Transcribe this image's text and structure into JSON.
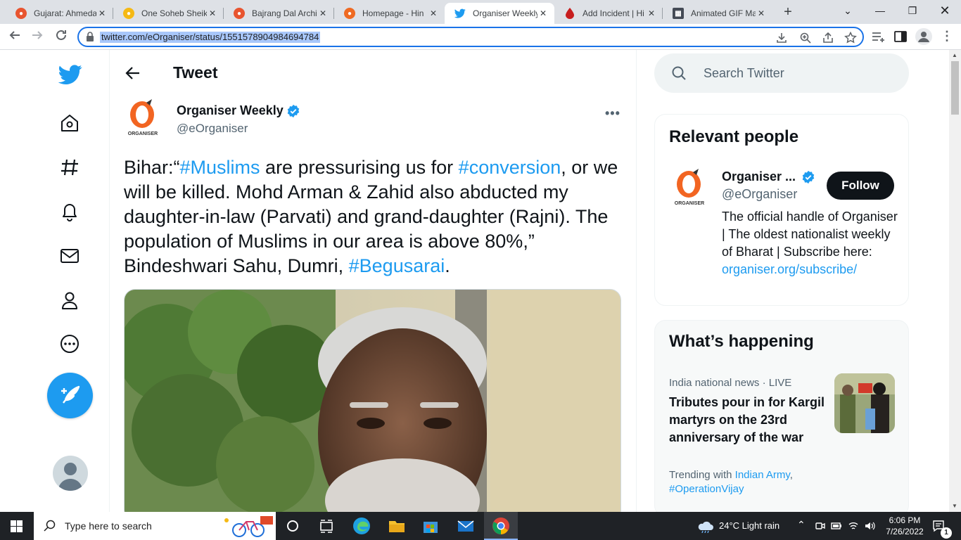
{
  "browser": {
    "tabs": [
      {
        "label": "Gujarat: Ahmedal",
        "color": "#e8542f",
        "active": false
      },
      {
        "label": "One Soheb Sheik",
        "color": "#f5b914",
        "active": false
      },
      {
        "label": "Bajrang Dal Archi",
        "color": "#e8542f",
        "active": false
      },
      {
        "label": "Homepage - Hin",
        "color": "#ef6a22",
        "active": false
      },
      {
        "label": "Organiser Weekly",
        "color": "#1d9bf0",
        "active": true
      },
      {
        "label": "Add Incident | Hi",
        "color": "#c71e1e",
        "active": false
      },
      {
        "label": "Animated GIF Ma",
        "color": "#444a55",
        "active": false
      }
    ],
    "url": "twitter.com/eOrganiser/status/1551578904984694784"
  },
  "nav": {
    "items": [
      "twitter-logo",
      "home-icon",
      "explore-icon",
      "notifications-icon",
      "messages-icon",
      "profile-icon",
      "more-icon"
    ]
  },
  "main": {
    "header_title": "Tweet",
    "author_name": "Organiser Weekly",
    "author_handle": "@eOrganiser",
    "tweet": {
      "t1": "Bihar:“",
      "h1": "#Muslims",
      "t2": " are pressurising us for ",
      "h2": "#conversion",
      "t3": ", or we will be killed. Mohd Arman & Zahid also abducted my daughter-in-law (Parvati) and grand-daughter (Rajni). The population of Muslims in our area is above 80%,” Bindeshwari Sahu, Dumri, ",
      "h3": "#Begusarai",
      "t4": "."
    }
  },
  "sidebar": {
    "search_placeholder": "Search Twitter",
    "relevant": {
      "title": "Relevant people",
      "name": "Organiser ...",
      "handle": "@eOrganiser",
      "follow_label": "Follow",
      "bio": "The official handle of Organiser | The oldest nationalist weekly of Bharat | Subscribe here:",
      "bio_link": "organiser.org/subscribe/"
    },
    "happening": {
      "title": "What’s happening",
      "trend_meta": "India national news · LIVE",
      "trend_title": "Tributes pour in for Kargil martyrs on the 23rd anniversary of the war",
      "trend_sub_prefix": "Trending with",
      "trend_link1": "Indian Army",
      "trend_sep": ",",
      "trend_link2": "#OperationVijay"
    }
  },
  "taskbar": {
    "search_placeholder": "Type here to search",
    "weather": "24°C  Light rain",
    "time": "6:06 PM",
    "date": "7/26/2022",
    "notif_count": "1"
  }
}
